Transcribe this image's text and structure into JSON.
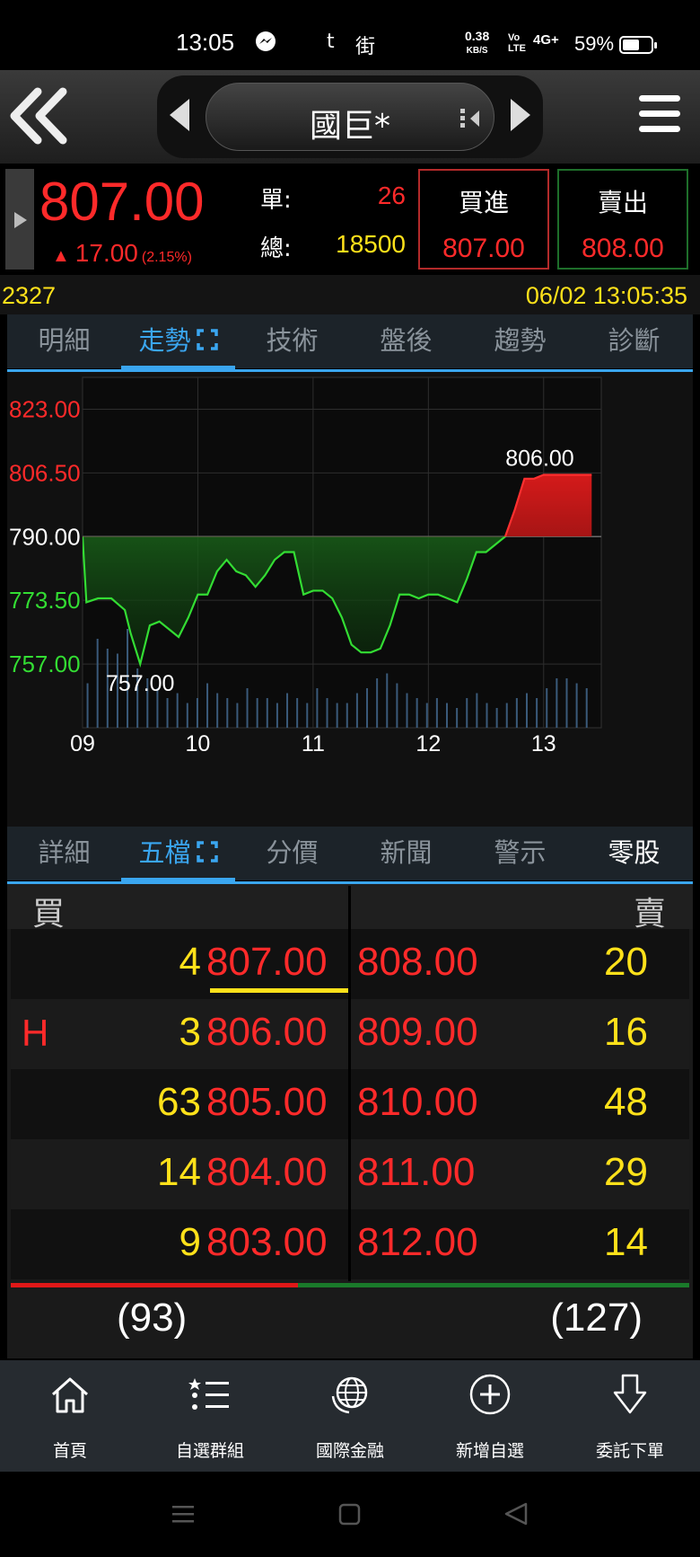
{
  "status_bar": {
    "time": "13:05",
    "app_icon_text": "t",
    "app_icon_text2": "街",
    "net_speed": "0.38",
    "net_unit": "KB/S",
    "volte": "Vo\nLTE",
    "signal": "4G+",
    "battery": "59%"
  },
  "header": {
    "stock_name": "國巨*"
  },
  "quote": {
    "last_price": "807.00",
    "change_arrow": "▲",
    "change": "17.00",
    "change_pct": "(2.15%)",
    "single_label": "單:",
    "single_vol": "26",
    "total_label": "總:",
    "total_vol": "18500",
    "buy_label": "買進",
    "buy_price": "807.00",
    "sell_label": "賣出",
    "sell_price": "808.00"
  },
  "info": {
    "code": "2327",
    "datetime": "06/02 13:05:35"
  },
  "top_tabs": [
    "明細",
    "走勢",
    "技術",
    "盤後",
    "趨勢",
    "診斷"
  ],
  "top_tabs_active": 1,
  "colors": {
    "up": "#ff2a2a",
    "down_fill": "#1f8a1f",
    "line_green": "#33dd33",
    "accent": "#3aa6f0",
    "yellow": "#ffe11a"
  },
  "chart_data": {
    "type": "area",
    "y_ticks": [
      "823.00",
      "806.50",
      "790.00",
      "773.50",
      "757.00"
    ],
    "y_tick_values": [
      823.0,
      806.5,
      790.0,
      773.5,
      757.0
    ],
    "x_ticks": [
      "09",
      "10",
      "11",
      "12",
      "13"
    ],
    "reference_price": 790.0,
    "ylim": [
      740.5,
      831.25
    ],
    "x_unit_note": "minutes from 09:00",
    "xlim": [
      0,
      270
    ],
    "high_label": "806.00",
    "low_label": "757.00",
    "series": [
      {
        "x": [
          0,
          2,
          8,
          15,
          22,
          25,
          30,
          35,
          40,
          45,
          50,
          55,
          60,
          65,
          70,
          75,
          80,
          85,
          90,
          95,
          100,
          105,
          110,
          115,
          120,
          125,
          130,
          135,
          140,
          145,
          150,
          155,
          160,
          165,
          170,
          175,
          180,
          185,
          190,
          195,
          200,
          205,
          210,
          215,
          220,
          225,
          230,
          235,
          240,
          245,
          250,
          255,
          260,
          265
        ],
        "y": [
          790,
          773,
          774,
          774,
          771,
          765,
          757,
          767,
          768,
          766,
          764,
          769,
          775,
          775,
          781,
          784,
          781,
          780,
          777,
          780,
          784,
          786,
          786,
          775,
          776,
          776,
          774,
          769,
          762,
          760,
          760,
          761,
          767,
          775,
          775,
          774,
          775,
          775,
          774,
          773,
          779,
          786,
          786,
          788,
          790,
          797,
          805,
          805,
          806,
          806,
          806,
          806,
          806,
          806
        ]
      }
    ],
    "volume_bars": [
      9,
      18,
      16,
      15,
      20,
      12,
      10,
      8,
      6,
      7,
      5,
      6,
      9,
      7,
      6,
      5,
      8,
      6,
      6,
      5,
      7,
      6,
      5,
      8,
      6,
      5,
      5,
      7,
      8,
      10,
      11,
      9,
      7,
      6,
      5,
      6,
      5,
      4,
      6,
      7,
      5,
      4,
      5,
      6,
      7,
      6,
      8,
      10,
      10,
      9,
      8
    ]
  },
  "bottom_tabs": [
    "詳細",
    "五檔",
    "分價",
    "新聞",
    "警示",
    "零股"
  ],
  "bottom_tabs_active": 1,
  "book": {
    "buy_label": "買",
    "sell_label": "賣",
    "rows": [
      {
        "mark": "",
        "buy_vol": "4",
        "buy_price": "807.00",
        "sell_price": "808.00",
        "sell_vol": "20"
      },
      {
        "mark": "H",
        "buy_vol": "3",
        "buy_price": "806.00",
        "sell_price": "809.00",
        "sell_vol": "16"
      },
      {
        "mark": "",
        "buy_vol": "63",
        "buy_price": "805.00",
        "sell_price": "810.00",
        "sell_vol": "48"
      },
      {
        "mark": "",
        "buy_vol": "14",
        "buy_price": "804.00",
        "sell_price": "811.00",
        "sell_vol": "29"
      },
      {
        "mark": "",
        "buy_vol": "9",
        "buy_price": "803.00",
        "sell_price": "812.00",
        "sell_vol": "14"
      }
    ],
    "buy_total": "(93)",
    "sell_total": "(127)",
    "buy_ratio": 0.4227
  },
  "nav": [
    {
      "label": "首頁",
      "icon": "home-icon"
    },
    {
      "label": "自選群組",
      "icon": "list-star-icon"
    },
    {
      "label": "國際金融",
      "icon": "globe-icon"
    },
    {
      "label": "新增自選",
      "icon": "add-circle-icon"
    },
    {
      "label": "委託下單",
      "icon": "order-arrow-icon"
    }
  ]
}
